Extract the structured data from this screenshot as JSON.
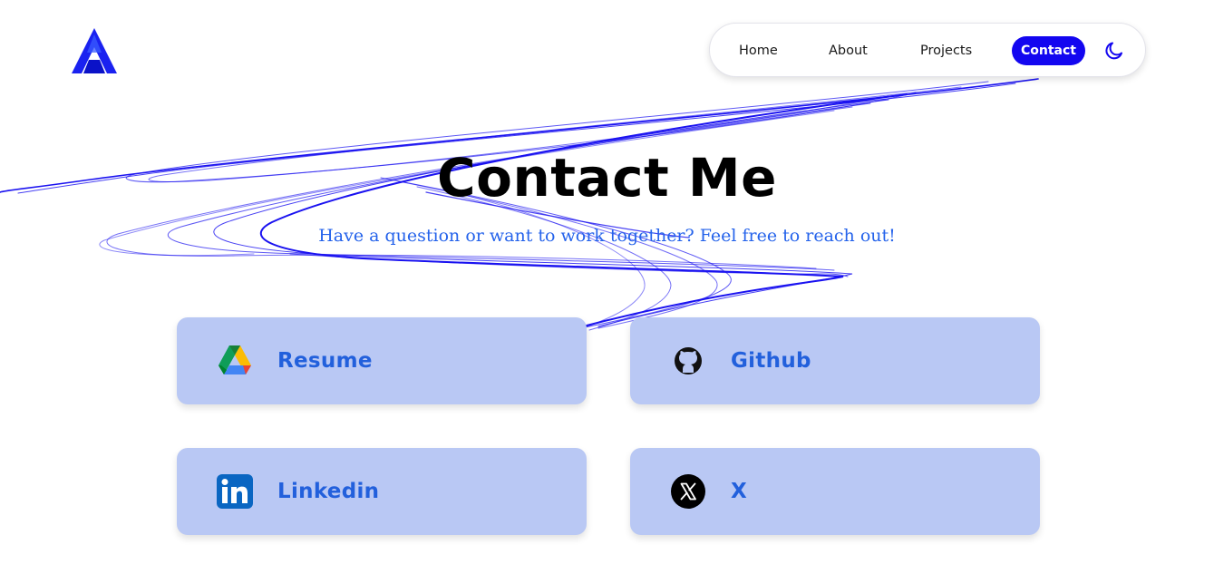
{
  "colors": {
    "accent": "#1306f0",
    "link": "#2563eb",
    "card_bg": "#b9c8f4"
  },
  "header": {
    "logo_icon": "triangle-a-logo",
    "nav": {
      "home": "Home",
      "about": "About",
      "projects": "Projects",
      "contact": "Contact",
      "active": "Contact"
    },
    "theme_toggle_icon": "moon-icon"
  },
  "hero": {
    "title": "Contact Me",
    "subtitle": "Have a question or want to work together? Feel free to reach out!"
  },
  "links": [
    {
      "label": "Resume",
      "icon": "google-drive-icon"
    },
    {
      "label": "Github",
      "icon": "github-icon"
    },
    {
      "label": "Linkedin",
      "icon": "linkedin-icon"
    },
    {
      "label": "X",
      "icon": "x-icon"
    }
  ]
}
